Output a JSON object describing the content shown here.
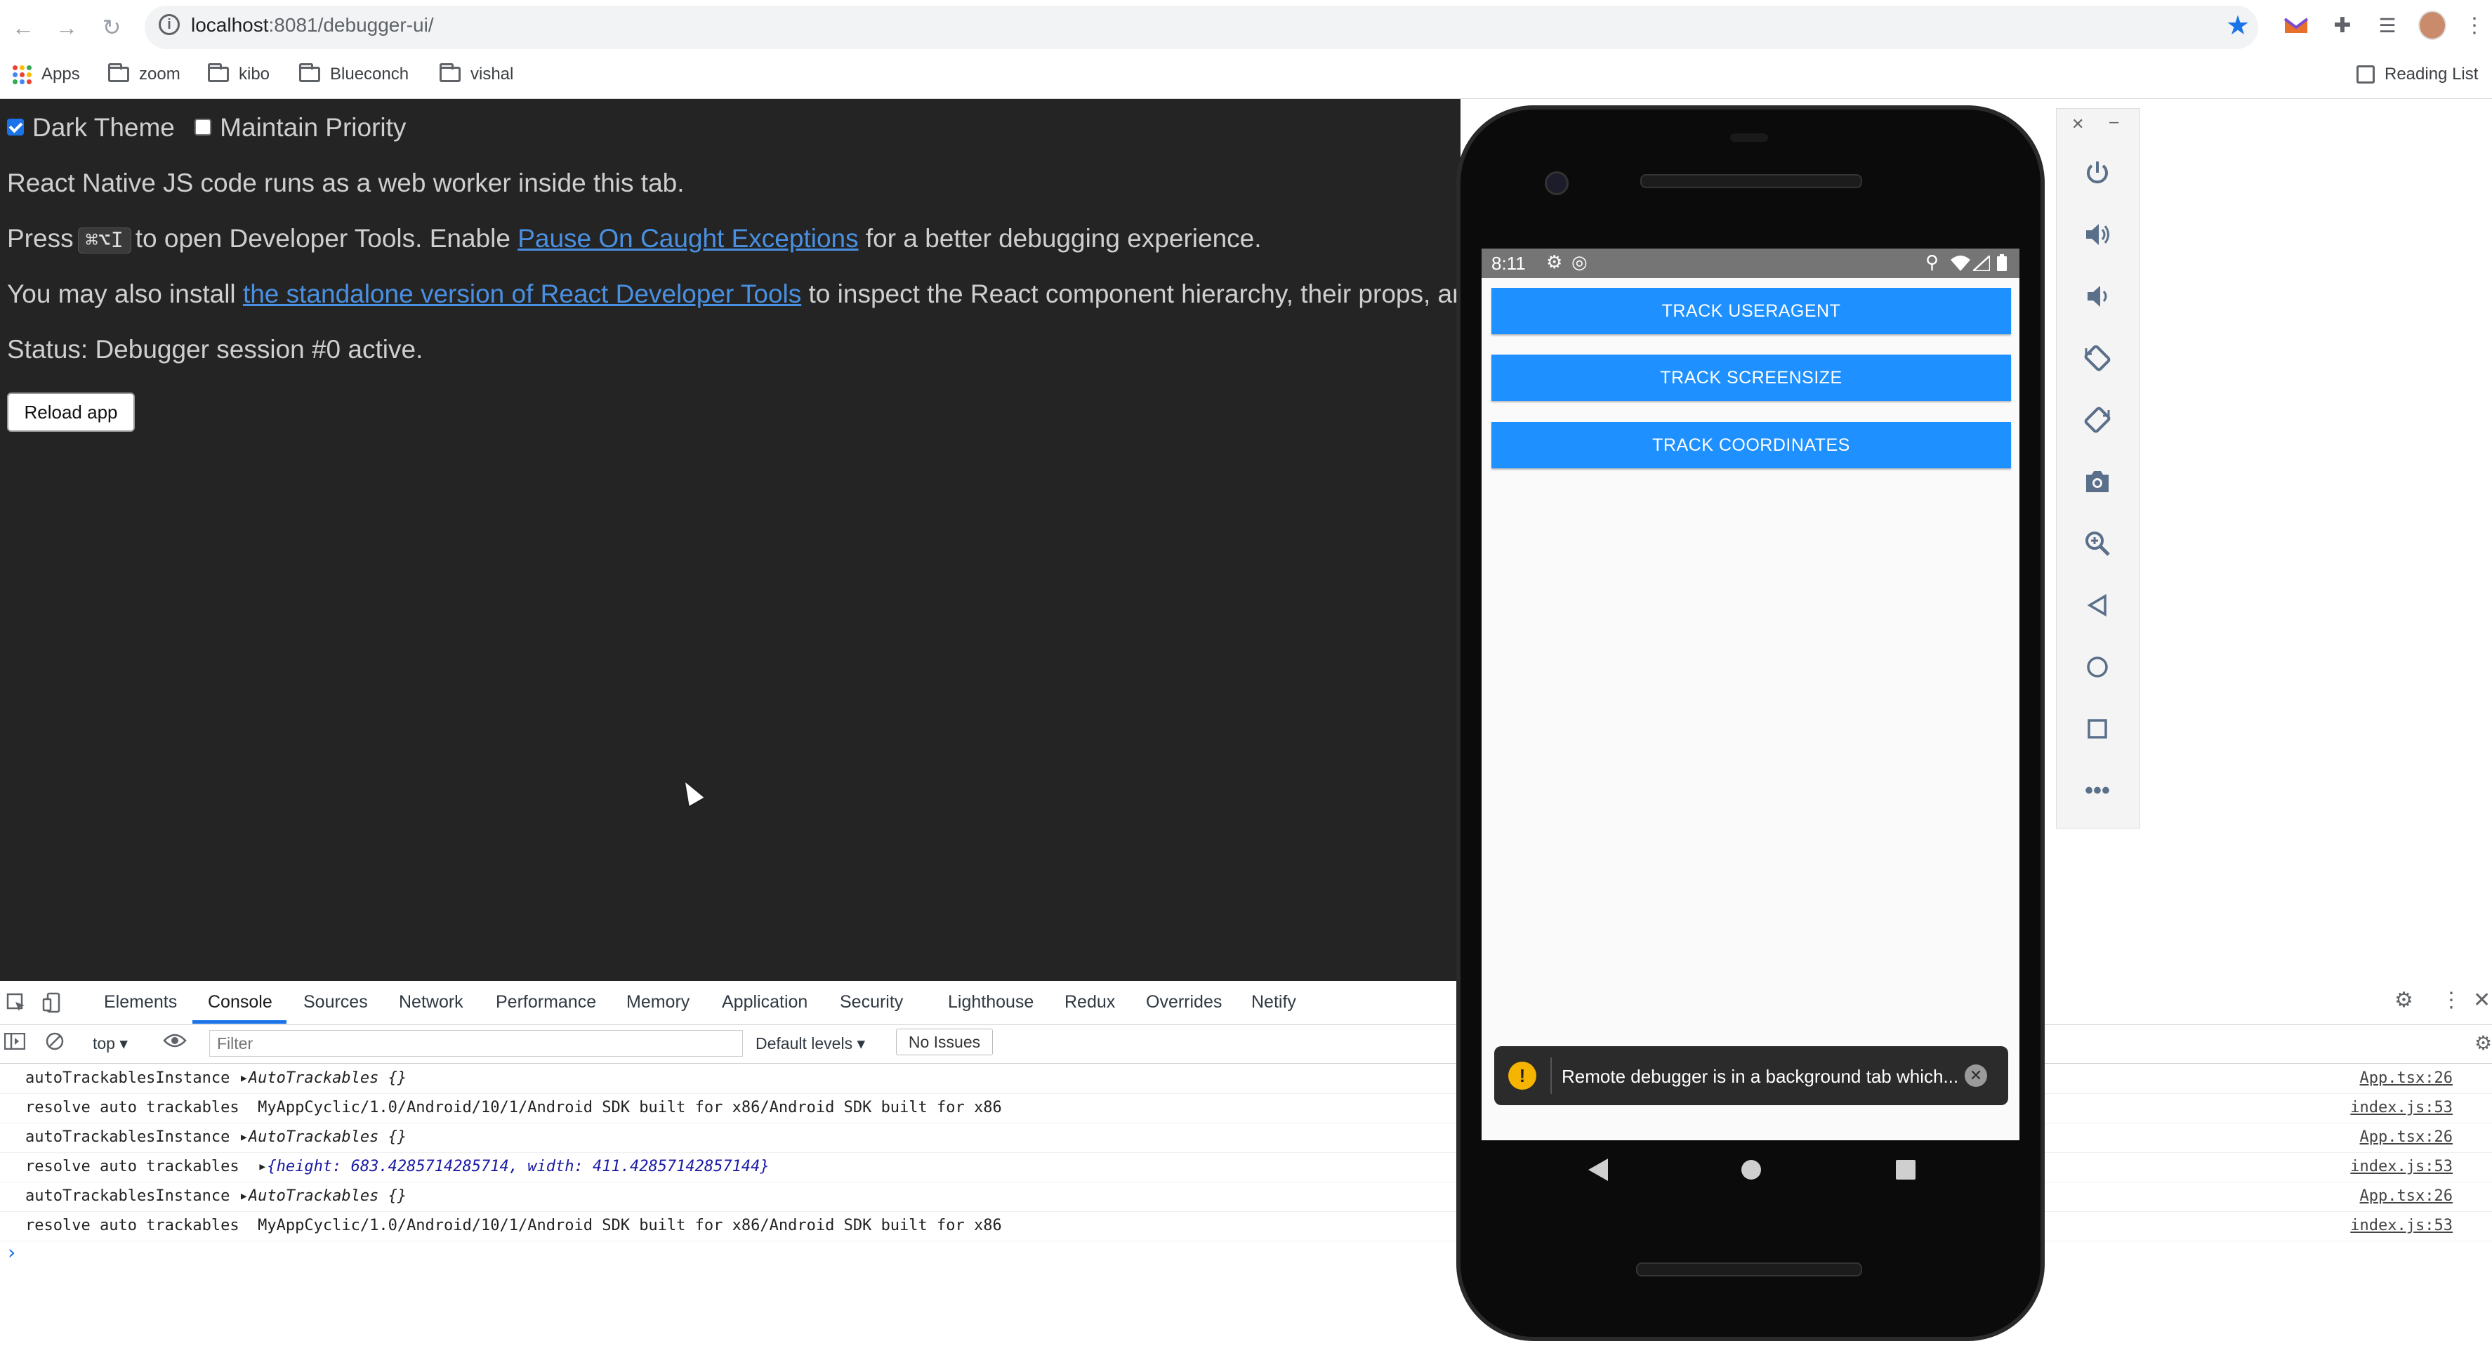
{
  "browser": {
    "url_host": "localhost",
    "url_path": ":8081/debugger-ui/",
    "bookmarks": [
      "Apps",
      "zoom",
      "kibo",
      "Blueconch",
      "vishal"
    ],
    "reading_list": "Reading List"
  },
  "page": {
    "dark_theme_label": "Dark Theme",
    "maintain_priority_label": "Maintain Priority",
    "line1": "React Native JS code runs as a web worker inside this tab.",
    "line2_a": "Press",
    "line2_kbd": "⌘⌥I",
    "line2_b": "to open Developer Tools. Enable",
    "line2_link": "Pause On Caught Exceptions",
    "line2_c": "for a better debugging experience.",
    "line3_a": "You may also install",
    "line3_link": "the standalone version of React Developer Tools",
    "line3_b": "to inspect the React component hierarchy, their props, and",
    "status": "Status: Debugger session #0 active.",
    "reload_label": "Reload app"
  },
  "devtools": {
    "tabs": [
      "Elements",
      "Console",
      "Sources",
      "Network",
      "Performance",
      "Memory",
      "Application",
      "Security",
      "Lighthouse",
      "Redux",
      "Overrides",
      "Netify"
    ],
    "active_tab": "Console",
    "context": "top",
    "filter_placeholder": "Filter",
    "levels": "Default levels",
    "issues": "No Issues",
    "logs": [
      {
        "a": "autoTrackablesInstance",
        "b": "AutoTrackables {}",
        "src": "App.tsx:26"
      },
      {
        "a": "resolve auto trackables",
        "b": "MyAppCyclic/1.0/Android/10/1/Android SDK built for x86/Android SDK built for x86",
        "src": "index.js:53"
      },
      {
        "a": "autoTrackablesInstance",
        "b": "AutoTrackables {}",
        "src": "App.tsx:26"
      },
      {
        "a": "resolve auto trackables",
        "b": "{height: 683.4285714285714, width: 411.42857142857144}",
        "src": "index.js:53"
      },
      {
        "a": "autoTrackablesInstance",
        "b": "AutoTrackables {}",
        "src": "App.tsx:26"
      },
      {
        "a": "resolve auto trackables",
        "b": "MyAppCyclic/1.0/Android/10/1/Android SDK built for x86/Android SDK built for x86",
        "src": "index.js:53"
      }
    ]
  },
  "emulator": {
    "time": "8:11",
    "buttons": [
      "TRACK USERAGENT",
      "TRACK SCREENSIZE",
      "TRACK COORDINATES"
    ],
    "toast": "Remote debugger is in a background tab which..."
  },
  "colors": {
    "accent": "#1a73e8",
    "button_blue": "#1e90ff",
    "page_bg": "#242424",
    "link": "#4a90e2"
  }
}
